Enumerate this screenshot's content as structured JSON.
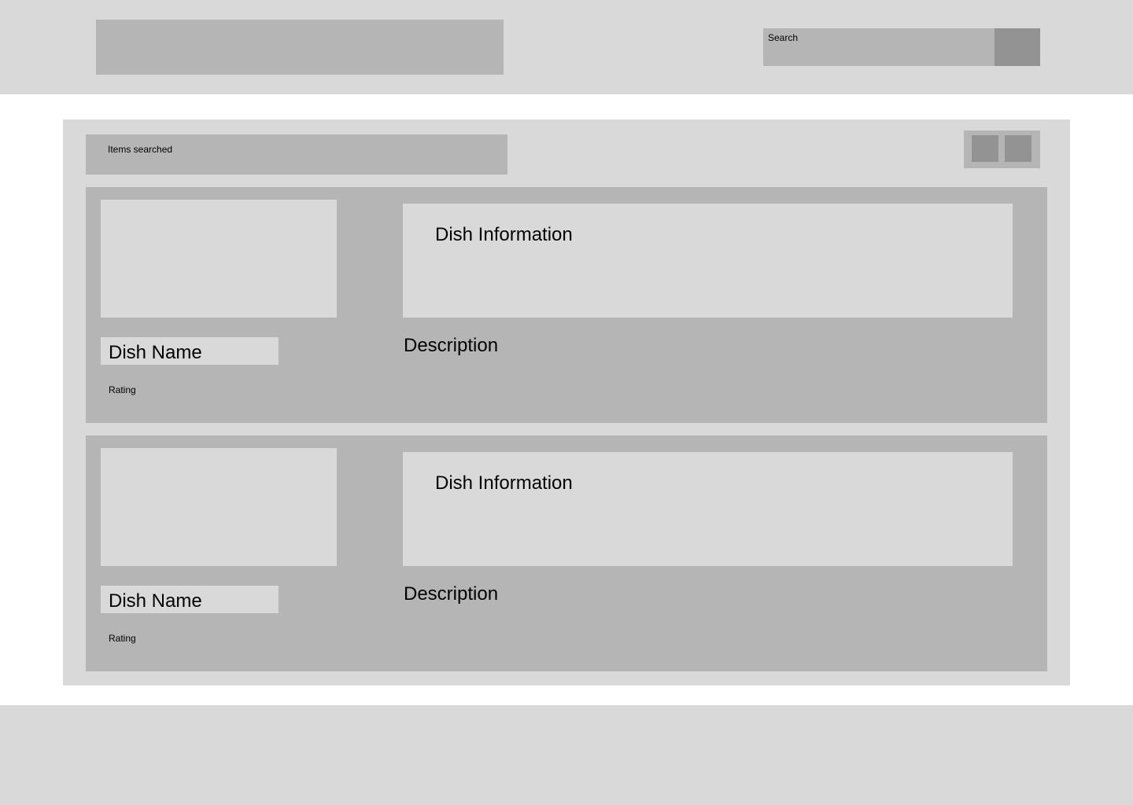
{
  "header": {
    "search": {
      "label": "Search"
    }
  },
  "results": {
    "summary_label": "Items searched",
    "cards": [
      {
        "dish_name": "Dish Name",
        "rating_label": "Rating",
        "info_title": "Dish Information",
        "description_label": "Description"
      },
      {
        "dish_name": "Dish Name",
        "rating_label": "Rating",
        "info_title": "Dish Information",
        "description_label": "Description"
      }
    ]
  },
  "colors": {
    "panel_light": "#d9d9d9",
    "panel_mid": "#b5b5b5",
    "button_dark": "#939393",
    "background": "#ffffff"
  }
}
